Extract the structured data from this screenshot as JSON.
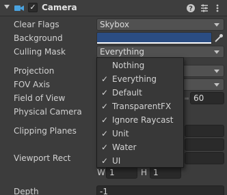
{
  "header": {
    "title": "Camera",
    "enabled": true,
    "icons": [
      "foldout-arrow-icon",
      "camera-icon",
      "help-icon",
      "presets-icon",
      "more-icon"
    ]
  },
  "properties": {
    "clear_flags": {
      "label": "Clear Flags",
      "value": "Skybox"
    },
    "background": {
      "label": "Background",
      "color": "#2b4d83"
    },
    "culling_mask": {
      "label": "Culling Mask",
      "value": "Everything"
    },
    "projection": {
      "label": "Projection"
    },
    "fov_axis": {
      "label": "FOV Axis"
    },
    "field_of_view": {
      "label": "Field of View",
      "value": "60"
    },
    "physical_camera": {
      "label": "Physical Camera"
    },
    "clipping_planes": {
      "label": "Clipping Planes"
    },
    "viewport_rect": {
      "label": "Viewport Rect",
      "w_label": "W",
      "w_value": "1",
      "h_label": "H",
      "h_value": "1"
    },
    "depth": {
      "label": "Depth",
      "value": "-1"
    }
  },
  "culling_mask_menu": {
    "items": [
      {
        "label": "Nothing",
        "checked": false
      },
      {
        "label": "Everything",
        "checked": true
      },
      {
        "label": "Default",
        "checked": true
      },
      {
        "label": "TransparentFX",
        "checked": true
      },
      {
        "label": "Ignore Raycast",
        "checked": true
      },
      {
        "label": "Unit",
        "checked": true
      },
      {
        "label": "Water",
        "checked": true
      },
      {
        "label": "UI",
        "checked": true
      }
    ],
    "check_glyph": "✓"
  },
  "colors": {
    "panel_bg": "#3c3c3c",
    "field_bg": "#515151",
    "dark_field_bg": "#2a2a2a",
    "popup_bg": "#383838",
    "text": "#d2d2d2"
  }
}
